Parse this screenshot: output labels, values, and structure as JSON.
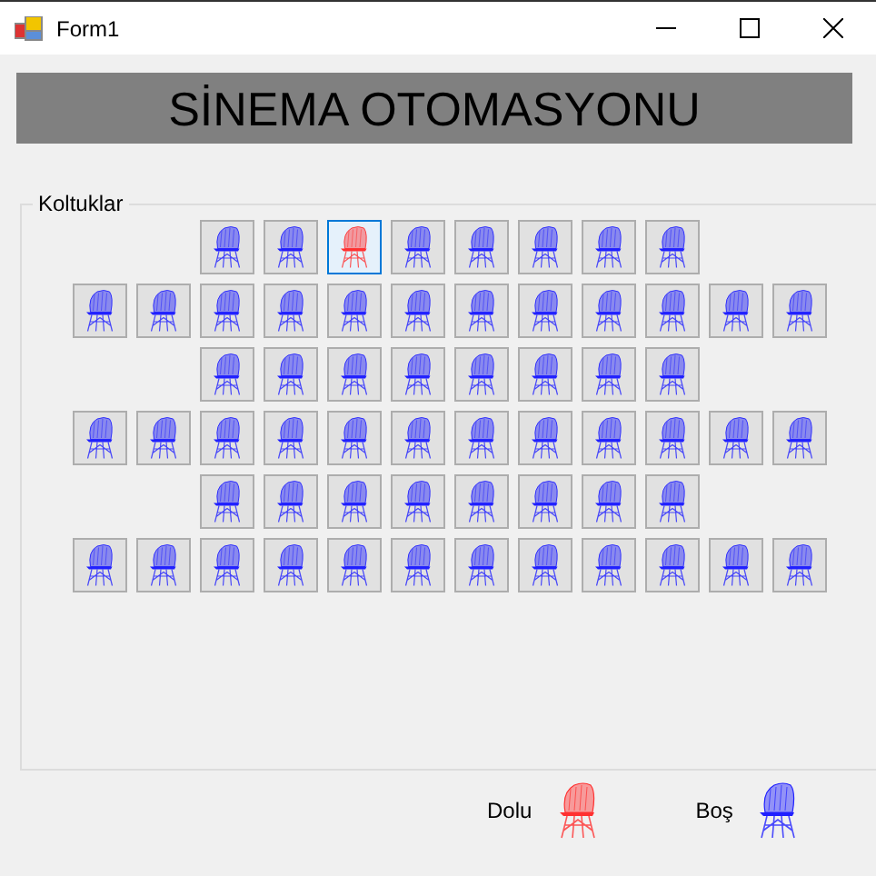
{
  "window": {
    "title": "Form1"
  },
  "banner": "SİNEMA OTOMASYONU",
  "group": {
    "label": "Koltuklar"
  },
  "seat_rows": [
    {
      "seats": [
        {
          "full": false,
          "selected": false
        },
        {
          "full": false,
          "selected": false
        },
        {
          "full": true,
          "selected": true
        },
        {
          "full": false,
          "selected": false
        },
        {
          "full": false,
          "selected": false
        },
        {
          "full": false,
          "selected": false
        },
        {
          "full": false,
          "selected": false
        },
        {
          "full": false,
          "selected": false
        }
      ]
    },
    {
      "seats": [
        {
          "full": false,
          "selected": false
        },
        {
          "full": false,
          "selected": false
        },
        {
          "full": false,
          "selected": false
        },
        {
          "full": false,
          "selected": false
        },
        {
          "full": false,
          "selected": false
        },
        {
          "full": false,
          "selected": false
        },
        {
          "full": false,
          "selected": false
        },
        {
          "full": false,
          "selected": false
        },
        {
          "full": false,
          "selected": false
        },
        {
          "full": false,
          "selected": false
        },
        {
          "full": false,
          "selected": false
        },
        {
          "full": false,
          "selected": false
        }
      ]
    },
    {
      "seats": [
        {
          "full": false,
          "selected": false
        },
        {
          "full": false,
          "selected": false
        },
        {
          "full": false,
          "selected": false
        },
        {
          "full": false,
          "selected": false
        },
        {
          "full": false,
          "selected": false
        },
        {
          "full": false,
          "selected": false
        },
        {
          "full": false,
          "selected": false
        },
        {
          "full": false,
          "selected": false
        }
      ]
    },
    {
      "seats": [
        {
          "full": false,
          "selected": false
        },
        {
          "full": false,
          "selected": false
        },
        {
          "full": false,
          "selected": false
        },
        {
          "full": false,
          "selected": false
        },
        {
          "full": false,
          "selected": false
        },
        {
          "full": false,
          "selected": false
        },
        {
          "full": false,
          "selected": false
        },
        {
          "full": false,
          "selected": false
        },
        {
          "full": false,
          "selected": false
        },
        {
          "full": false,
          "selected": false
        },
        {
          "full": false,
          "selected": false
        },
        {
          "full": false,
          "selected": false
        }
      ]
    },
    {
      "seats": [
        {
          "full": false,
          "selected": false
        },
        {
          "full": false,
          "selected": false
        },
        {
          "full": false,
          "selected": false
        },
        {
          "full": false,
          "selected": false
        },
        {
          "full": false,
          "selected": false
        },
        {
          "full": false,
          "selected": false
        },
        {
          "full": false,
          "selected": false
        },
        {
          "full": false,
          "selected": false
        }
      ]
    },
    {
      "seats": [
        {
          "full": false,
          "selected": false
        },
        {
          "full": false,
          "selected": false
        },
        {
          "full": false,
          "selected": false
        },
        {
          "full": false,
          "selected": false
        },
        {
          "full": false,
          "selected": false
        },
        {
          "full": false,
          "selected": false
        },
        {
          "full": false,
          "selected": false
        },
        {
          "full": false,
          "selected": false
        },
        {
          "full": false,
          "selected": false
        },
        {
          "full": false,
          "selected": false
        },
        {
          "full": false,
          "selected": false
        },
        {
          "full": false,
          "selected": false
        }
      ]
    }
  ],
  "legend": [
    {
      "label": "Dolu",
      "full": true
    },
    {
      "label": "Boş",
      "full": false
    }
  ]
}
